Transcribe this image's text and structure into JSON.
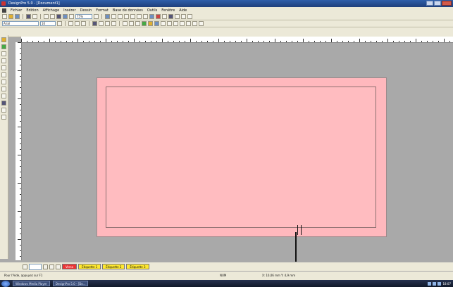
{
  "window": {
    "title": "DesignPro 5.0 - [Document1]"
  },
  "menu": [
    "Fichier",
    "Edition",
    "Affichage",
    "Insérer",
    "Dessin",
    "Format",
    "Base de données",
    "Outils",
    "Fenêtre",
    "Aide"
  ],
  "toolbar": {
    "zoom": "75%",
    "font": "Arial",
    "font_size": "10"
  },
  "tabs": [
    {
      "label": "Verso",
      "color": "red"
    },
    {
      "label": "Étiquette 1",
      "color": "yellow"
    },
    {
      "label": "Étiquette 2",
      "color": "yellow"
    },
    {
      "label": "Étiquette 3",
      "color": "yellow"
    }
  ],
  "status": {
    "help": "Pour l'Aide, appuyez sur F1",
    "mode": "NUM",
    "position": "X: 10,06 mm  Y: 4,9 mm"
  },
  "taskbar": {
    "tasks": [
      "Windows Media Player",
      "DesignPro 5.0 - [Do..."
    ],
    "clock": "18:07"
  },
  "colors": {
    "card": "#ffb8bd",
    "workspace": "#a9a9a9"
  }
}
